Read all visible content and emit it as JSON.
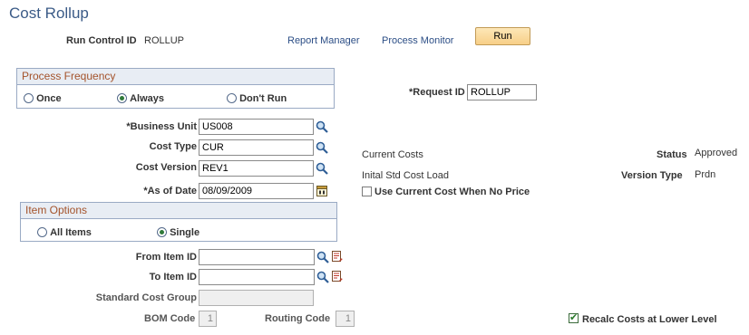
{
  "page": {
    "title": "Cost Rollup"
  },
  "header": {
    "run_control_label": "Run Control ID",
    "run_control_value": "ROLLUP",
    "report_manager": "Report Manager",
    "process_monitor": "Process Monitor",
    "run_button": "Run"
  },
  "process_frequency": {
    "title": "Process Frequency",
    "options": [
      {
        "label": "Once",
        "selected": false
      },
      {
        "label": "Always",
        "selected": true
      },
      {
        "label": "Don't Run",
        "selected": false
      }
    ]
  },
  "request_id": {
    "label": "*Request ID",
    "value": "ROLLUP"
  },
  "fields": {
    "business_unit": {
      "label": "*Business Unit",
      "value": "US008"
    },
    "cost_type": {
      "label": "Cost Type",
      "value": "CUR",
      "description": "Current Costs"
    },
    "cost_version": {
      "label": "Cost Version",
      "value": "REV1",
      "description": "Inital Std Cost Load"
    },
    "as_of_date": {
      "label": "*As of Date",
      "value": "08/09/2009"
    }
  },
  "status": {
    "label": "Status",
    "value": "Approved"
  },
  "version_type": {
    "label": "Version Type",
    "value": "Prdn"
  },
  "use_current_cost": {
    "label": "Use Current Cost When No Price",
    "checked": false
  },
  "item_options": {
    "title": "Item Options",
    "options": [
      {
        "label": "All Items",
        "selected": false
      },
      {
        "label": "Single",
        "selected": true
      }
    ]
  },
  "items": {
    "from_item": {
      "label": "From Item ID",
      "value": ""
    },
    "to_item": {
      "label": "To Item ID",
      "value": ""
    },
    "std_cost_group": {
      "label": "Standard Cost Group",
      "value": ""
    },
    "bom_code": {
      "label": "BOM Code",
      "value": "1"
    },
    "routing_code": {
      "label": "Routing Code",
      "value": "1"
    }
  },
  "recalc": {
    "label": "Recalc Costs at Lower Level",
    "checked": true
  },
  "icons": {
    "search": "magnifier-icon",
    "calendar": "calendar-icon",
    "detail": "detail-page-icon"
  },
  "colors": {
    "title": "#3b5b87",
    "group_header_text": "#a4532b",
    "group_header_bg": "#e8edf4",
    "link": "#2c4e86",
    "button_bg": "#f7cf87"
  }
}
